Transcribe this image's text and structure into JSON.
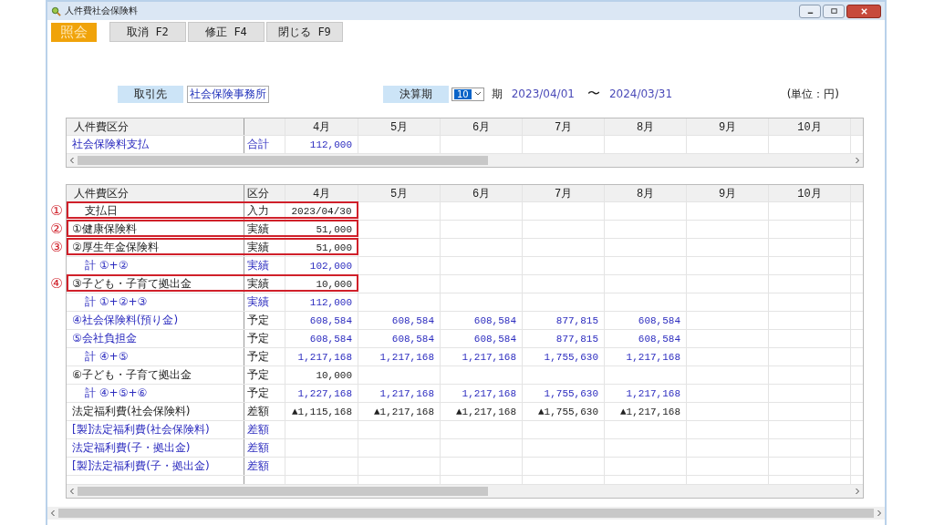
{
  "window": {
    "title": "人件費社会保険料"
  },
  "toolbar": {
    "mode": "照会",
    "buttons": [
      "取消 F2",
      "修正 F4",
      "閉じる F9"
    ]
  },
  "header": {
    "client_label": "取引先",
    "client_value": "社会保険事務所",
    "period_label": "決算期",
    "period_value": "10",
    "period_suffix": "期",
    "start_date": "2023/04/01",
    "range_sep": "〜",
    "end_date": "2024/03/31",
    "unit": "(単位：円)"
  },
  "summary_table": {
    "columns": [
      "人件費区分",
      "4月",
      "5月",
      "6月",
      "7月",
      "8月",
      "9月",
      "10月"
    ],
    "rows": [
      {
        "label": "社会保険料支払",
        "kubun": "合計",
        "values": [
          "112,000"
        ]
      }
    ]
  },
  "detail_table": {
    "columns": [
      "人件費区分",
      "区分",
      "4月",
      "5月",
      "6月",
      "7月",
      "8月",
      "9月",
      "10月"
    ],
    "rows": [
      {
        "kind": "date",
        "label": "支払日",
        "kubun": "入力",
        "values": [
          "2023/04/30"
        ],
        "callout": "①"
      },
      {
        "kind": "actual",
        "label": "①健康保険料",
        "kubun": "実績",
        "values": [
          "51,000"
        ],
        "callout": "②"
      },
      {
        "kind": "actual",
        "label": "②厚生年金保険料",
        "kubun": "実績",
        "values": [
          "51,000"
        ],
        "callout": "③"
      },
      {
        "kind": "actual_total",
        "label": "計 ①+②",
        "kubun": "実績",
        "values": [
          "102,000"
        ]
      },
      {
        "kind": "actual",
        "label": "③子ども・子育て拠出金",
        "kubun": "実績",
        "values": [
          "10,000"
        ],
        "callout": "④"
      },
      {
        "kind": "actual_total",
        "label": "計 ①+②+③",
        "kubun": "実績",
        "values": [
          "112,000"
        ]
      },
      {
        "kind": "plan",
        "label": "④社会保険料(預り金)",
        "kubun": "予定",
        "values": [
          "608,584",
          "608,584",
          "608,584",
          "877,815",
          "608,584"
        ]
      },
      {
        "kind": "plan",
        "label": "⑤会社負担金",
        "kubun": "予定",
        "values": [
          "608,584",
          "608,584",
          "608,584",
          "877,815",
          "608,584"
        ]
      },
      {
        "kind": "plan_total",
        "label": "計 ④+⑤",
        "kubun": "予定",
        "values": [
          "1,217,168",
          "1,217,168",
          "1,217,168",
          "1,755,630",
          "1,217,168"
        ]
      },
      {
        "kind": "plan_entry",
        "label": "⑥子ども・子育て拠出金",
        "kubun": "予定",
        "values": [
          "10,000"
        ]
      },
      {
        "kind": "plan_total",
        "label": "計 ④+⑤+⑥",
        "kubun": "予定",
        "values": [
          "1,227,168",
          "1,217,168",
          "1,217,168",
          "1,755,630",
          "1,217,168"
        ]
      },
      {
        "kind": "difference",
        "label": "法定福利費(社会保険料)",
        "kubun": "差額",
        "values": [
          "▲1,115,168",
          "▲1,217,168",
          "▲1,217,168",
          "▲1,755,630",
          "▲1,217,168"
        ]
      },
      {
        "kind": "linked_difference",
        "label": "[製]法定福利費(社会保険料)",
        "kubun": "差額",
        "values": []
      },
      {
        "kind": "linked_difference",
        "label": "法定福利費(子・拠出金)",
        "kubun": "差額",
        "values": []
      },
      {
        "kind": "linked_difference",
        "label": "[製]法定福利費(子・拠出金)",
        "kubun": "差額",
        "values": []
      }
    ]
  }
}
